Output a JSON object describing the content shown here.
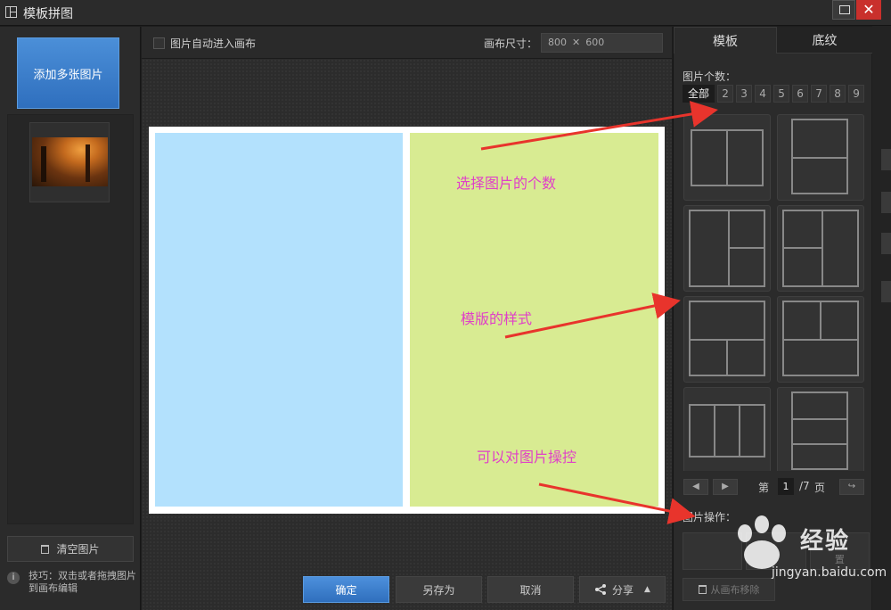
{
  "window": {
    "title": "模板拼图",
    "close_glyph": "✕"
  },
  "left": {
    "add_button": "添加多张图片",
    "clear_button": "清空图片",
    "tip_icon": "i",
    "tip_text": "技巧：双击或者拖拽图片到画布编辑"
  },
  "toolbar": {
    "auto_checkbox_label": "图片自动进入画布",
    "auto_checked": false,
    "size_label": "画布尺寸：",
    "width": "800",
    "times": "✕",
    "height": "600"
  },
  "annotations": {
    "count": "选择图片的个数",
    "style": "模版的样式",
    "ops": "可以对图片操控"
  },
  "bottom": {
    "confirm": "确定",
    "save_as": "另存为",
    "cancel": "取消",
    "share": "分享",
    "share_arrow": "▲"
  },
  "right": {
    "tabs": [
      "模板",
      "底纹"
    ],
    "count_label": "图片个数：",
    "count_options": [
      "全部",
      "2",
      "3",
      "4",
      "5",
      "6",
      "7",
      "8",
      "9"
    ],
    "pager": {
      "prefix": "第",
      "current": "1",
      "total": "/7",
      "suffix": "页",
      "prev": "◀",
      "next": "▶",
      "go": "↪"
    },
    "ops_label": "图片操作：",
    "op_buttons": [
      "",
      "",
      "置"
    ],
    "remove_button": "从画布移除"
  },
  "watermark": {
    "cn": "经验",
    "en": "jingyan.baidu.com"
  },
  "colors": {
    "left_cell": "#b3e1fd",
    "right_cell": "#d8eb92",
    "annotation": "#e040c8",
    "arrow": "#e8342c",
    "primary": "#3a7fd0"
  }
}
